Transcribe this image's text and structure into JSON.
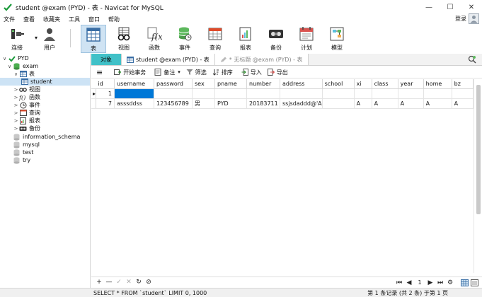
{
  "window": {
    "title": "student @exam (PYD) - 表 - Navicat for MySQL",
    "controls": {
      "minimize": "—",
      "maximize": "☐",
      "close": "✕"
    }
  },
  "menu": [
    "文件",
    "查看",
    "收藏夹",
    "工具",
    "窗口",
    "帮助"
  ],
  "login_label": "登录",
  "toolbar": {
    "items": [
      {
        "label": "连接",
        "icon": "connection-icon"
      },
      {
        "label": "用户",
        "icon": "user-icon"
      },
      {
        "label": "表",
        "icon": "table-icon",
        "active": true
      },
      {
        "label": "视图",
        "icon": "view-icon"
      },
      {
        "label": "函数",
        "icon": "function-icon"
      },
      {
        "label": "事件",
        "icon": "event-icon"
      },
      {
        "label": "查询",
        "icon": "query-icon"
      },
      {
        "label": "报表",
        "icon": "report-icon"
      },
      {
        "label": "备份",
        "icon": "backup-icon"
      },
      {
        "label": "计划",
        "icon": "schedule-icon"
      },
      {
        "label": "模型",
        "icon": "model-icon"
      }
    ]
  },
  "sidebar": {
    "tree": [
      {
        "label": "PYD",
        "icon": "connection-icon",
        "twisty": "∨"
      },
      {
        "label": "exam",
        "icon": "database-icon",
        "twisty": "∨"
      },
      {
        "label": "表",
        "icon": "table-icon",
        "twisty": "∨"
      },
      {
        "label": "student",
        "icon": "table-icon",
        "twisty": ""
      },
      {
        "label": "视图",
        "icon": "view-icon",
        "twisty": ">"
      },
      {
        "label": "函数",
        "icon": "function-icon",
        "twisty": ">"
      },
      {
        "label": "事件",
        "icon": "event-icon",
        "twisty": ">"
      },
      {
        "label": "查询",
        "icon": "query-icon",
        "twisty": ">"
      },
      {
        "label": "报表",
        "icon": "report-icon",
        "twisty": ">"
      },
      {
        "label": "备份",
        "icon": "backup-icon",
        "twisty": ">"
      },
      {
        "label": "information_schema",
        "icon": "database-icon",
        "twisty": ""
      },
      {
        "label": "mysql",
        "icon": "database-icon",
        "twisty": ""
      },
      {
        "label": "test",
        "icon": "database-icon",
        "twisty": ""
      },
      {
        "label": "try",
        "icon": "database-icon",
        "twisty": ""
      }
    ]
  },
  "tabs": [
    {
      "label": "对象"
    },
    {
      "label": "student @exam (PYD) - 表"
    },
    {
      "label": "* 无标题 @exam (PYD) - 表"
    }
  ],
  "grid_toolbar": {
    "menu_icon": "≡",
    "begin_transaction": "开始事务",
    "memo": "备注",
    "filter": "筛选",
    "sort": "排序",
    "import": "导入",
    "export": "导出"
  },
  "table": {
    "columns": [
      "id",
      "username",
      "password",
      "sex",
      "pname",
      "number",
      "address",
      "school",
      "xi",
      "class",
      "year",
      "home",
      "bz"
    ],
    "rows": [
      [
        "1",
        "",
        "",
        "",
        "",
        "",
        "",
        "",
        "",
        "",
        "",
        "",
        ""
      ],
      [
        "7",
        "asssddss",
        "123456789",
        "男",
        "PYD",
        "20183711",
        "ssjsdaddd@'A",
        "",
        "A",
        "A",
        "A",
        "A",
        "A"
      ]
    ],
    "current_row_marker": "▸"
  },
  "bottom": {
    "buttons": [
      "+",
      "—",
      "✓",
      "✕",
      "↻",
      "⊘"
    ],
    "page": "1"
  },
  "status": {
    "sql": "SELECT * FROM `student` LIMIT 0, 1000",
    "records": "第 1 条记录 (共 2 条) 于第 1 页"
  },
  "colors": {
    "objects_tab": "#41c1c8",
    "selection": "#0078d7",
    "active_toolbar": "#cfe3f3"
  }
}
